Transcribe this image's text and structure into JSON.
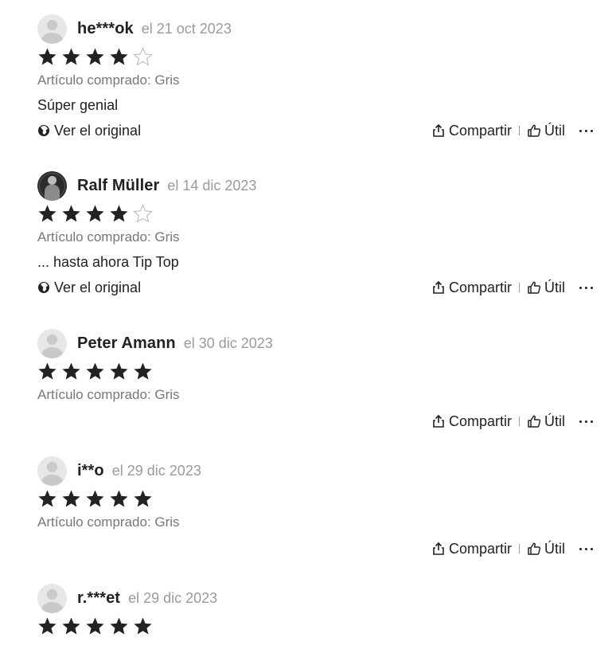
{
  "reviews": [
    {
      "username": "he***ok",
      "date": "el 21 oct 2023",
      "rating": 4,
      "purchased": "Artículo comprado: Gris",
      "comment": "Súper genial",
      "view_original": "Ver el original"
    },
    {
      "username": "Ralf Müller",
      "date": "el 14 dic 2023",
      "rating": 4,
      "purchased": "Artículo comprado: Gris",
      "comment": "... hasta ahora Tip Top",
      "view_original": "Ver el original"
    },
    {
      "username": "Peter Amann",
      "date": "el 30 dic 2023",
      "rating": 5,
      "purchased": "Artículo comprado: Gris"
    },
    {
      "username": "i**o",
      "date": "el 29 dic 2023",
      "rating": 5,
      "purchased": "Artículo comprado: Gris"
    },
    {
      "username": "r.***et",
      "date": "el 29 dic 2023",
      "rating": 5
    }
  ],
  "actions": {
    "share_label": "Compartir",
    "helpful_label": "Útil"
  },
  "icons": {
    "globe": "globe-icon",
    "share": "share-icon",
    "helpful": "thumbs-up-icon",
    "more": "more-icon",
    "star_filled": "star-filled-icon",
    "star_empty": "star-outline-icon"
  },
  "colors": {
    "text": "#222222",
    "muted": "#777777",
    "date": "#9b9b9b",
    "star": "#222222"
  }
}
